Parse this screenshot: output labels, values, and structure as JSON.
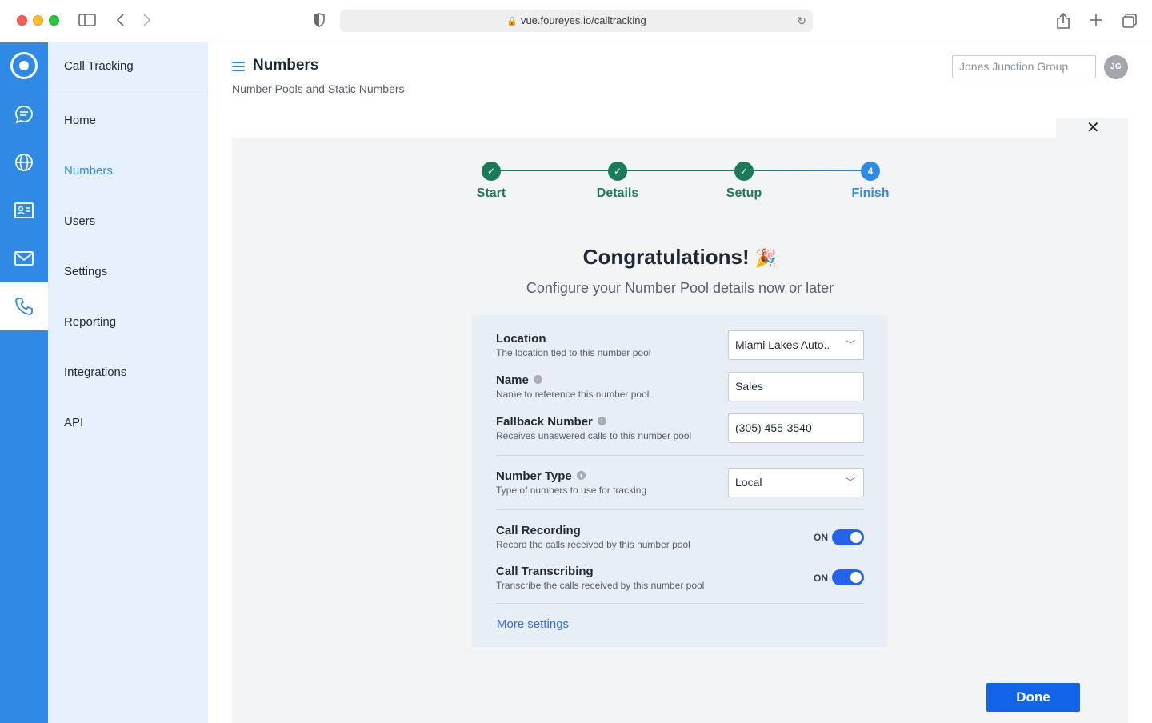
{
  "browser": {
    "url": "vue.foureyes.io/calltracking"
  },
  "sidebar": {
    "title": "Call Tracking",
    "items": [
      {
        "label": "Home"
      },
      {
        "label": "Numbers"
      },
      {
        "label": "Users"
      },
      {
        "label": "Settings"
      },
      {
        "label": "Reporting"
      },
      {
        "label": "Integrations"
      },
      {
        "label": "API"
      }
    ]
  },
  "header": {
    "title": "Numbers",
    "subtitle": "Number Pools and Static Numbers",
    "account_placeholder": "Jones Junction Group",
    "avatar_initials": "JG"
  },
  "stepper": {
    "steps": [
      {
        "label": "Start",
        "state": "done"
      },
      {
        "label": "Details",
        "state": "done"
      },
      {
        "label": "Setup",
        "state": "done"
      },
      {
        "label": "Finish",
        "state": "current",
        "number": "4"
      }
    ]
  },
  "content": {
    "heading": "Congratulations!",
    "heading_emoji": "🎉",
    "subheading": "Configure your Number Pool details now or later"
  },
  "form": {
    "location": {
      "label": "Location",
      "help": "The location tied to this number pool",
      "value": "Miami Lakes Auto.."
    },
    "name": {
      "label": "Name",
      "help": "Name to reference this number pool",
      "value": "Sales"
    },
    "fallback": {
      "label": "Fallback Number",
      "help": "Receives unaswered calls to this number pool",
      "value": "(305) 455-3540"
    },
    "number_type": {
      "label": "Number Type",
      "help": "Type of numbers to use for tracking",
      "value": "Local"
    },
    "call_recording": {
      "label": "Call Recording",
      "help": "Record the calls received by this number pool",
      "state": "ON"
    },
    "call_transcribing": {
      "label": "Call Transcribing",
      "help": "Transcribe the calls received by this number pool",
      "state": "ON"
    },
    "more_settings": "More settings"
  },
  "actions": {
    "done": "Done"
  },
  "colors": {
    "brand_blue": "#2f8ae5",
    "step_done": "#1a7a5a",
    "primary_button": "#1263e8"
  }
}
